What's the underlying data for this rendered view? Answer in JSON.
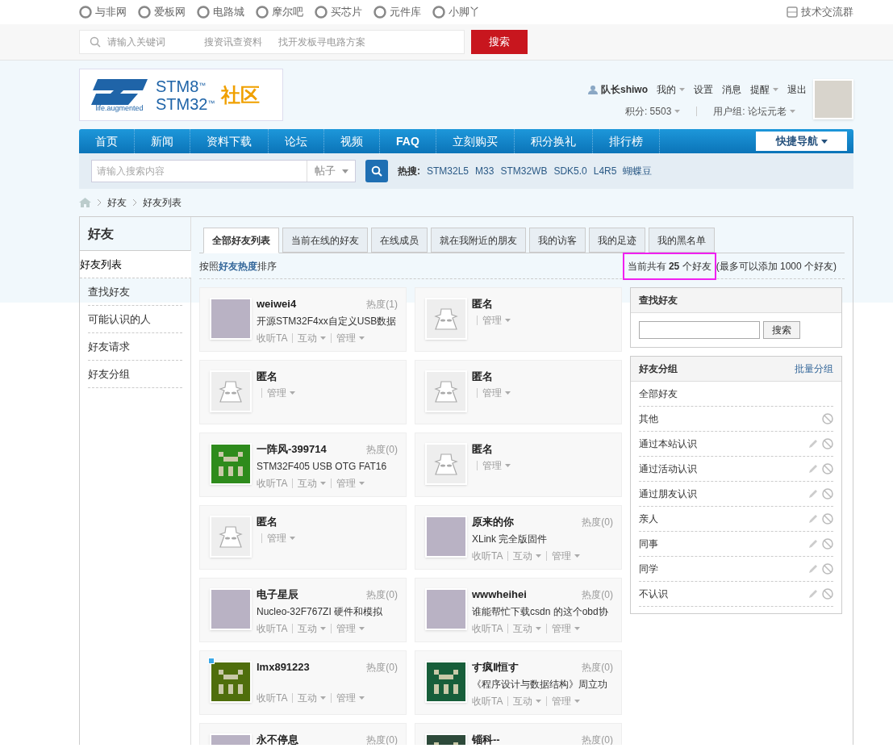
{
  "site_links": [
    {
      "label": "与非网"
    },
    {
      "label": "爱板网"
    },
    {
      "label": "电路城"
    },
    {
      "label": "摩尔吧"
    },
    {
      "label": "买芯片"
    },
    {
      "label": "元件库"
    },
    {
      "label": "小脚丫"
    }
  ],
  "group_link": "技术交流群",
  "top_search": {
    "placeholder": "请输入关键词",
    "hints": [
      "搜资讯查资料",
      "找开发板寻电路方案"
    ],
    "button": "搜索"
  },
  "logo": {
    "tagline": "life.augmented",
    "line_1": "STM8",
    "line_2": "STM32",
    "mark": "™",
    "community": "社区"
  },
  "user": {
    "name": "队长shiwo",
    "menu": [
      {
        "label": "我的",
        "menu": true
      },
      {
        "label": "设置",
        "menu": false
      },
      {
        "label": "消息",
        "menu": false
      },
      {
        "label": "提醒",
        "menu": true
      },
      {
        "label": "退出",
        "menu": false
      }
    ],
    "points": "积分: 5503",
    "group": "用户组: 论坛元老"
  },
  "nav": {
    "items": [
      "首页",
      "新闻",
      "资料下载",
      "论坛",
      "视频",
      "FAQ",
      "立刻购买",
      "积分换礼",
      "排行榜"
    ],
    "quick_nav": "快捷导航"
  },
  "site_search": {
    "placeholder": "请输入搜索内容",
    "scope": "帖子",
    "hot_label": "热搜:",
    "hot": [
      "STM32L5",
      "M33",
      "STM32WB",
      "SDK5.0",
      "L4R5",
      "蝴蝶豆"
    ]
  },
  "breadcrumb": [
    "好友",
    "好友列表"
  ],
  "sidebar": {
    "title": "好友",
    "items": [
      {
        "label": "好友列表",
        "selected": true
      },
      {
        "label": "查找好友",
        "selected": false
      },
      {
        "label": "可能认识的人",
        "selected": false
      },
      {
        "label": "好友请求",
        "selected": false
      },
      {
        "label": "好友分组",
        "selected": false
      }
    ]
  },
  "tabs": [
    {
      "label": "全部好友列表",
      "selected": true
    },
    {
      "label": "当前在线的好友",
      "selected": false
    },
    {
      "label": "在线成员",
      "selected": false
    },
    {
      "label": "就在我附近的朋友",
      "selected": false
    },
    {
      "label": "我的访客",
      "selected": false
    },
    {
      "label": "我的足迹",
      "selected": false
    },
    {
      "label": "我的黑名单",
      "selected": false
    }
  ],
  "sort_note": "按照**好友热度**排序",
  "friend_count": {
    "text": "当前共有 **25** 个好友",
    "limit": "(最多可以添加 1000 个好友)",
    "highlighted": true
  },
  "friends": [
    {
      "name": "weiwei4",
      "heat": "热度(1)",
      "note": "开源STM32F4xx自定义USB数据",
      "kind": "photo",
      "online": false,
      "actions": [
        {
          "label": "收听TA",
          "menu": false
        },
        {
          "label": "互动",
          "menu": true
        },
        {
          "label": "管理",
          "menu": true
        }
      ]
    },
    {
      "name": "匿名",
      "kind": "anonymous",
      "online": false,
      "actions": [
        {
          "label": "管理",
          "menu": true
        }
      ]
    },
    {
      "name": "匿名",
      "kind": "anonymous",
      "online": false,
      "actions": [
        {
          "label": "管理",
          "menu": true
        }
      ]
    },
    {
      "name": "匿名",
      "kind": "anonymous",
      "online": false,
      "actions": [
        {
          "label": "管理",
          "menu": true
        }
      ]
    },
    {
      "name": "一阵风-399714",
      "heat": "热度(0)",
      "note": "STM32F405 USB OTG FAT16",
      "kind": "identicon",
      "color": "#2e8b1c",
      "online": false,
      "actions": [
        {
          "label": "收听TA",
          "menu": false
        },
        {
          "label": "互动",
          "menu": true
        },
        {
          "label": "管理",
          "menu": true
        }
      ]
    },
    {
      "name": "匿名",
      "kind": "anonymous",
      "online": false,
      "actions": [
        {
          "label": "管理",
          "menu": true
        }
      ]
    },
    {
      "name": "匿名",
      "kind": "anonymous",
      "online": false,
      "actions": [
        {
          "label": "管理",
          "menu": true
        }
      ]
    },
    {
      "name": "原来的你",
      "heat": "热度(0)",
      "note": "XLink 完全版固件",
      "kind": "photo",
      "online": false,
      "actions": [
        {
          "label": "收听TA",
          "menu": false
        },
        {
          "label": "互动",
          "menu": true
        },
        {
          "label": "管理",
          "menu": true
        }
      ]
    },
    {
      "name": "电子星辰",
      "heat": "热度(0)",
      "note": "Nucleo-32F767ZI 硬件和模拟",
      "kind": "photo",
      "online": false,
      "actions": [
        {
          "label": "收听TA",
          "menu": false
        },
        {
          "label": "互动",
          "menu": true
        },
        {
          "label": "管理",
          "menu": true
        }
      ]
    },
    {
      "name": "wwwheihei",
      "heat": "热度(0)",
      "note": "谁能帮忙下载csdn 的这个obd协",
      "kind": "photo",
      "online": false,
      "actions": [
        {
          "label": "收听TA",
          "menu": false
        },
        {
          "label": "互动",
          "menu": true
        },
        {
          "label": "管理",
          "menu": true
        }
      ]
    },
    {
      "name": "lmx891223",
      "heat": "热度(0)",
      "kind": "identicon",
      "color": "#4f6e0c",
      "online": true,
      "actions": [
        {
          "label": "收听TA",
          "menu": false
        },
        {
          "label": "互动",
          "menu": true
        },
        {
          "label": "管理",
          "menu": true
        }
      ]
    },
    {
      "name": "す疯Ⅱ恒す",
      "heat": "热度(0)",
      "note": "《程序设计与数据结构》周立功",
      "kind": "identicon",
      "color": "#175e3a",
      "online": false,
      "actions": [
        {
          "label": "收听TA",
          "menu": false
        },
        {
          "label": "互动",
          "menu": true
        },
        {
          "label": "管理",
          "menu": true
        }
      ]
    },
    {
      "name": "永不停息",
      "heat": "热度(0)",
      "kind": "photo",
      "online": false
    },
    {
      "name": "锱科--",
      "heat": "热度(0)",
      "kind": "identicon",
      "color": "#2d4a3a",
      "online": false
    }
  ],
  "find_friend": {
    "title": "查找好友",
    "button": "搜索"
  },
  "groups": {
    "title": "好友分组",
    "batch": "批量分组",
    "items": [
      {
        "label": "全部好友",
        "editable": false,
        "deletable": false
      },
      {
        "label": "其他",
        "editable": false,
        "deletable": true
      },
      {
        "label": "通过本站认识",
        "editable": true,
        "deletable": true
      },
      {
        "label": "通过活动认识",
        "editable": true,
        "deletable": true
      },
      {
        "label": "通过朋友认识",
        "editable": true,
        "deletable": true
      },
      {
        "label": "亲人",
        "editable": true,
        "deletable": true
      },
      {
        "label": "同事",
        "editable": true,
        "deletable": true
      },
      {
        "label": "同学",
        "editable": true,
        "deletable": true
      },
      {
        "label": "不认识",
        "editable": true,
        "deletable": true
      }
    ]
  }
}
